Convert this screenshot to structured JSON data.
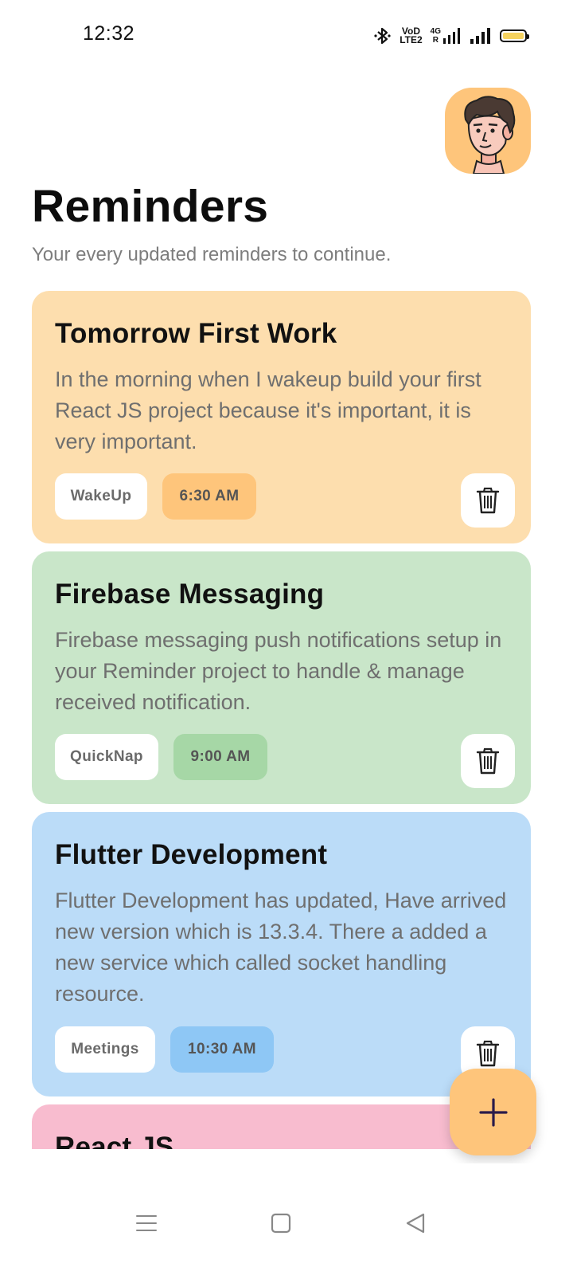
{
  "status_bar": {
    "time": "12:32",
    "icons": [
      "bluetooth-icon",
      "volte-icon",
      "4g-signal-icon",
      "signal-icon",
      "battery-icon"
    ],
    "volte_text": "VoD\nLTE2",
    "net_text": "4G\nR",
    "battery_color": "#f6d35f"
  },
  "header": {
    "title": "Reminders",
    "subtitle": "Your every updated reminders to continue.",
    "avatar_bg": "#fec57b"
  },
  "reminders": [
    {
      "title": "Tomorrow First Work",
      "description": "In the morning when I wakeup build your first React JS project because it's important, it is very important.",
      "tag": "WakeUp",
      "time": "6:30 AM",
      "card_color": "#fddeae",
      "time_color": "#fec57b"
    },
    {
      "title": "Firebase Messaging",
      "description": "Firebase messaging push notifications setup in your Reminder project to handle & manage received notification.",
      "tag": "QuickNap",
      "time": "9:00 AM",
      "card_color": "#c9e6c9",
      "time_color": "#a6d7a6"
    },
    {
      "title": "Flutter Development",
      "description": "Flutter Development has updated, Have arrived new version which is 13.3.4. There a added a new service which called socket handling resource.",
      "tag": "Meetings",
      "time": "10:30 AM",
      "card_color": "#bbdcf8",
      "time_color": "#8ec7f5"
    },
    {
      "title": "React JS",
      "card_color": "#f8bccf"
    }
  ],
  "fab": {
    "icon": "plus-icon",
    "color": "#fec57b",
    "icon_color": "#2a1b4a"
  },
  "nav_bar": {
    "icons": [
      "menu-icon",
      "home-square-icon",
      "back-triangle-icon"
    ]
  }
}
